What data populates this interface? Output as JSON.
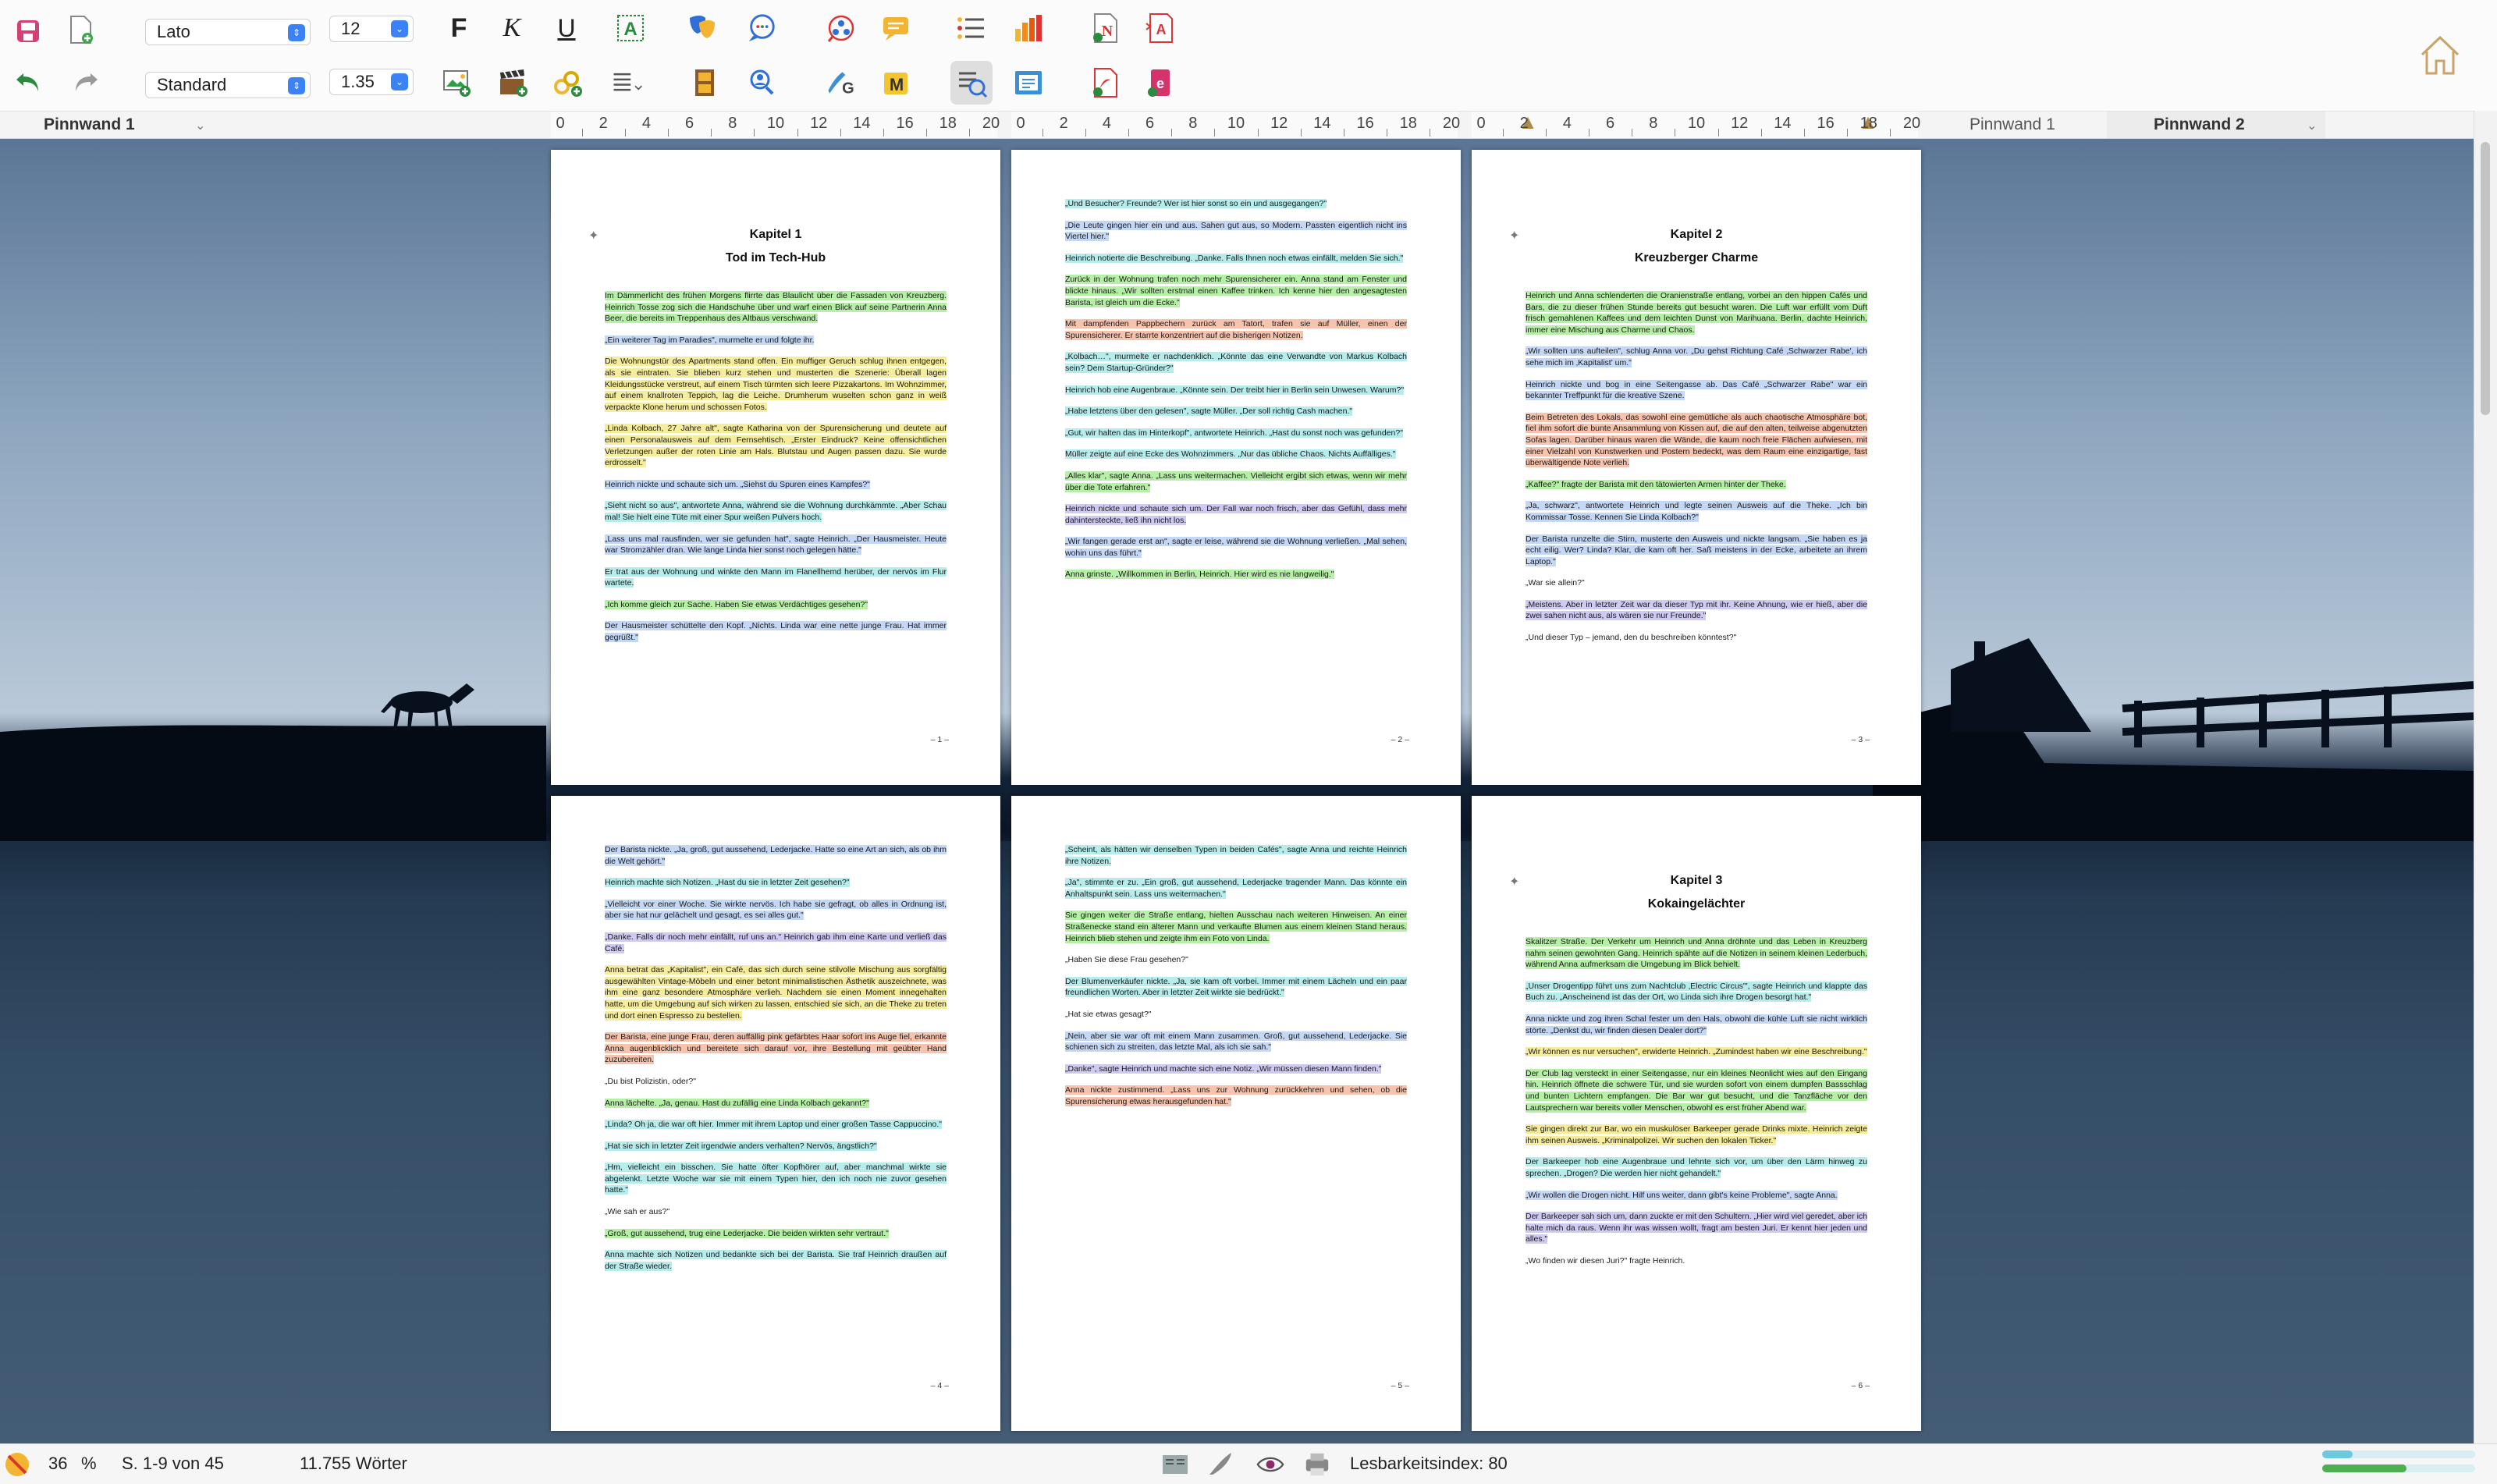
{
  "toolbar": {
    "font_family": "Lato",
    "font_size": "12",
    "style": "Standard",
    "line_spacing": "1.35",
    "bold_label": "F",
    "italic_label": "K",
    "underline_label": "U",
    "icons": [
      "save-icon",
      "new-document-icon",
      "bold-icon",
      "italic-icon",
      "underline-icon",
      "text-style-icon",
      "theater-masks-icon",
      "speech-bubbles-icon",
      "network-icon",
      "comment-icon",
      "list-icon",
      "bar-chart-icon",
      "name-list-icon",
      "text-analysis-icon",
      "undo-icon",
      "redo-icon",
      "add-picture-icon",
      "clapperboard-icon",
      "connect-icon",
      "list-format-icon",
      "timeline-icon",
      "person-search-icon",
      "edit-icon",
      "marker-icon",
      "review-icon",
      "export-icon",
      "pdf-icon",
      "ebook-icon",
      "home-icon"
    ]
  },
  "ruler_row": {
    "board_left": "Pinnwand 1",
    "board_right_1": "Pinnwand 1",
    "board_right_2": "Pinnwand 2",
    "ticks": [
      "0",
      "2",
      "4",
      "6",
      "8",
      "10",
      "12",
      "14",
      "16",
      "18",
      "20"
    ]
  },
  "pages": [
    {
      "chapter_num": "Kapitel 1",
      "chapter_title": "Tod im Tech-Hub",
      "page_label": "– 1 –",
      "paragraphs": [
        {
          "h": "green",
          "text": "Im Dämmerlicht des frühen Morgens flirrte das Blaulicht über die Fassaden von Kreuzberg. Heinrich Tosse zog sich die Handschuhe über und warf einen Blick auf seine Partnerin Anna Beer, die bereits im Treppenhaus des Altbaus verschwand."
        },
        {
          "h": "blue",
          "text": "„Ein weiterer Tag im Paradies\", murmelte er und folgte ihr."
        },
        {
          "h": "yellow",
          "text": "Die Wohnungstür des Apartments stand offen. Ein muffiger Geruch schlug ihnen entgegen, als sie eintraten. Sie blieben kurz stehen und musterten die Szenerie: Überall lagen Kleidungsstücke verstreut, auf einem Tisch türmten sich leere Pizzakartons. Im Wohnzimmer, auf einem knallroten Teppich, lag die Leiche. Drumherum wuselten schon ganz in weiß verpackte Klone herum und schossen Fotos."
        },
        {
          "h": "yellow",
          "text": "„Linda Kolbach, 27 Jahre alt\", sagte Katharina von der Spurensicherung und deutete auf einen Personalausweis auf dem Fernsehtisch. „Erster Eindruck? Keine offensichtlichen Verletzungen außer der roten Linie am Hals. Blutstau und Augen passen dazu. Sie wurde erdrosselt.\""
        },
        {
          "h": "blue",
          "text": "Heinrich nickte und schaute sich um. „Siehst du Spuren eines Kampfes?\""
        },
        {
          "h": "cyan",
          "text": "„Sieht nicht so aus\", antwortete Anna, während sie die Wohnung durchkämmte. „Aber Schau mal! Sie hielt eine Tüte mit einer Spur weißen Pulvers hoch."
        },
        {
          "h": "blue",
          "text": "„Lass uns mal rausfinden, wer sie gefunden hat\", sagte Heinrich. „Der Hausmeister. Heute war Stromzähler dran. Wie lange Linda hier sonst noch gelegen hätte.\""
        },
        {
          "h": "cyan",
          "text": "Er trat aus der Wohnung und winkte den Mann im Flanellhemd herüber, der nervös im Flur wartete."
        },
        {
          "h": "green",
          "text": "„Ich komme gleich zur Sache. Haben Sie etwas Verdächtiges gesehen?\""
        },
        {
          "h": "blue",
          "text": "Der Hausmeister schüttelte den Kopf. „Nichts. Linda war eine nette junge Frau. Hat immer gegrüßt.\""
        }
      ]
    },
    {
      "chapter_num": "",
      "chapter_title": "",
      "page_label": "– 2 –",
      "paragraphs": [
        {
          "h": "cyan",
          "text": "„Und Besucher? Freunde? Wer ist hier sonst so ein und ausgegangen?\""
        },
        {
          "h": "blue",
          "text": "„Die Leute gingen hier ein und aus. Sahen gut aus, so Modern. Passten eigentlich nicht ins Viertel hier.\""
        },
        {
          "h": "cyan",
          "text": "Heinrich notierte die Beschreibung. „Danke. Falls Ihnen noch etwas einfällt, melden Sie sich.\""
        },
        {
          "h": "green",
          "text": "Zurück in der Wohnung trafen noch mehr Spurensicherer ein. Anna stand am Fenster und blickte hinaus. „Wir sollten erstmal einen Kaffee trinken. Ich kenne hier den angesagtesten Barista, ist gleich um die Ecke.\""
        },
        {
          "h": "orange",
          "text": "Mit dampfenden Pappbechern zurück am Tatort, trafen sie auf Müller, einen der Spurensicherer. Er starrte konzentriert auf die bisherigen Notizen."
        },
        {
          "h": "cyan",
          "text": "„Kolbach…\", murmelte er nachdenklich. „Könnte das eine Verwandte von Markus Kolbach sein? Dem Startup-Gründer?\""
        },
        {
          "h": "cyan",
          "text": "Heinrich hob eine Augenbraue. „Könnte sein. Der treibt hier in Berlin sein Unwesen. Warum?\""
        },
        {
          "h": "cyan",
          "text": "„Habe letztens über den gelesen\", sagte Müller. „Der soll richtig Cash machen.\""
        },
        {
          "h": "cyan",
          "text": "„Gut, wir halten das im Hinterkopf\", antwortete Heinrich. „Hast du sonst noch was gefunden?\""
        },
        {
          "h": "cyan",
          "text": "Müller zeigte auf eine Ecke des Wohnzimmers. „Nur das übliche Chaos. Nichts Auffälliges.\""
        },
        {
          "h": "green",
          "text": "„Alles klar\", sagte Anna. „Lass uns weitermachen. Vielleicht ergibt sich etwas, wenn wir mehr über die Tote erfahren.\""
        },
        {
          "h": "purple",
          "text": "Heinrich nickte und schaute sich um. Der Fall war noch frisch, aber das Gefühl, dass mehr dahintersteckte, ließ ihn nicht los."
        },
        {
          "h": "blue",
          "text": "„Wir fangen gerade erst an\", sagte er leise, während sie die Wohnung verließen. „Mal sehen, wohin uns das führt.\""
        },
        {
          "h": "green",
          "text": "Anna grinste. „Willkommen in Berlin, Heinrich. Hier wird es nie langweilig.\""
        }
      ]
    },
    {
      "chapter_num": "Kapitel 2",
      "chapter_title": "Kreuzberger Charme",
      "page_label": "– 3 –",
      "paragraphs": [
        {
          "h": "green",
          "text": "Heinrich und Anna schlenderten die Oranienstraße entlang, vorbei an den hippen Cafés und Bars, die zu dieser frühen Stunde bereits gut besucht waren. Die Luft war erfüllt vom Duft frisch gemahlenen Kaffees und dem leichten Dunst von Marihuana. Berlin, dachte Heinrich, immer eine Mischung aus Charme und Chaos."
        },
        {
          "h": "blue",
          "text": "„Wir sollten uns aufteilen\", schlug Anna vor. „Du gehst Richtung Café ‚Schwarzer Rabe', ich sehe mich im ‚Kapitalist' um.\""
        },
        {
          "h": "blue",
          "text": "Heinrich nickte und bog in eine Seitengasse ab. Das Café „Schwarzer Rabe\" war ein bekannter Treffpunkt für die kreative Szene."
        },
        {
          "h": "orange",
          "text": "Beim Betreten des Lokals, das sowohl eine gemütliche als auch chaotische Atmosphäre bot, fiel ihm sofort die bunte Ansammlung von Kissen auf, die auf den alten, teilweise abgenutzten Sofas lagen. Darüber hinaus waren die Wände, die kaum noch freie Flächen aufwiesen, mit einer Vielzahl von Kunstwerken und Postern bedeckt, was dem Raum eine einzigartige, fast überwältigende Note verlieh."
        },
        {
          "h": "green",
          "text": "„Kaffee?\" fragte der Barista mit den tätowierten Armen hinter der Theke."
        },
        {
          "h": "blue",
          "text": "„Ja, schwarz\", antwortete Heinrich und legte seinen Ausweis auf die Theke. „Ich bin Kommissar Tosse. Kennen Sie Linda Kolbach?\""
        },
        {
          "h": "blue",
          "text": "Der Barista runzelte die Stirn, musterte den Ausweis und nickte langsam. „Sie haben es ja echt eilig. Wer? Linda? Klar, die kam oft her. Saß meistens in der Ecke, arbeitete an ihrem Laptop.\""
        },
        {
          "h": "none",
          "text": "„War sie allein?\""
        },
        {
          "h": "purple",
          "text": "„Meistens. Aber in letzter Zeit war da dieser Typ mit ihr. Keine Ahnung, wie er hieß, aber die zwei sahen nicht aus, als wären sie nur Freunde.\""
        },
        {
          "h": "none",
          "text": "„Und dieser Typ – jemand, den du beschreiben könntest?\""
        }
      ]
    },
    {
      "chapter_num": "",
      "chapter_title": "",
      "page_label": "– 4 –",
      "paragraphs": [
        {
          "h": "blue",
          "text": "Der Barista nickte. „Ja, groß, gut aussehend, Lederjacke. Hatte so eine Art an sich, als ob ihm die Welt gehört.\""
        },
        {
          "h": "cyan",
          "text": "Heinrich machte sich Notizen. „Hast du sie in letzter Zeit gesehen?\""
        },
        {
          "h": "blue",
          "text": "„Vielleicht vor einer Woche. Sie wirkte nervös. Ich habe sie gefragt, ob alles in Ordnung ist, aber sie hat nur gelächelt und gesagt, es sei alles gut.\""
        },
        {
          "h": "purple",
          "text": "„Danke. Falls dir noch mehr einfällt, ruf uns an.\" Heinrich gab ihm eine Karte und verließ das Café."
        },
        {
          "h": "yellow",
          "text": "Anna betrat das „Kapitalist\", ein Café, das sich durch seine stilvolle Mischung aus sorgfältig ausgewählten Vintage-Möbeln und einer betont minimalistischen Ästhetik auszeichnete, was ihm eine ganz besondere Atmosphäre verlieh. Nachdem sie einen Moment innegehalten hatte, um die Umgebung auf sich wirken zu lassen, entschied sie sich, an die Theke zu treten und dort einen Espresso zu bestellen."
        },
        {
          "h": "orange",
          "text": "Der Barista, eine junge Frau, deren auffällig pink gefärbtes Haar sofort ins Auge fiel, erkannte Anna augenblicklich und bereitete sich darauf vor, ihre Bestellung mit geübter Hand zuzubereiten."
        },
        {
          "h": "none",
          "text": "„Du bist Polizistin, oder?\""
        },
        {
          "h": "green",
          "text": "Anna lächelte. „Ja, genau. Hast du zufällig eine Linda Kolbach gekannt?\""
        },
        {
          "h": "cyan",
          "text": "„Linda? Oh ja, die war oft hier. Immer mit ihrem Laptop und einer großen Tasse Cappuccino.\""
        },
        {
          "h": "cyan",
          "text": "„Hat sie sich in letzter Zeit irgendwie anders verhalten? Nervös, ängstlich?\""
        },
        {
          "h": "cyan",
          "text": "„Hm, vielleicht ein bisschen. Sie hatte öfter Kopfhörer auf, aber manchmal wirkte sie abgelenkt. Letzte Woche war sie mit einem Typen hier, den ich noch nie zuvor gesehen hatte.\""
        },
        {
          "h": "none",
          "text": "„Wie sah er aus?\""
        },
        {
          "h": "green",
          "text": "„Groß, gut aussehend, trug eine Lederjacke. Die beiden wirkten sehr vertraut.\""
        },
        {
          "h": "cyan",
          "text": "Anna machte sich Notizen und bedankte sich bei der Barista. Sie traf Heinrich draußen auf der Straße wieder."
        }
      ]
    },
    {
      "chapter_num": "",
      "chapter_title": "",
      "page_label": "– 5 –",
      "paragraphs": [
        {
          "h": "cyan",
          "text": "„Scheint, als hätten wir denselben Typen in beiden Cafés\", sagte Anna und reichte Heinrich ihre Notizen."
        },
        {
          "h": "cyan",
          "text": "„Ja\", stimmte er zu. „Ein groß, gut aussehend, Lederjacke tragender Mann. Das könnte ein Anhaltspunkt sein. Lass uns weitermachen.\""
        },
        {
          "h": "green",
          "text": "Sie gingen weiter die Straße entlang, hielten Ausschau nach weiteren Hinweisen. An einer Straßenecke stand ein älterer Mann und verkaufte Blumen aus einem kleinen Stand heraus. Heinrich blieb stehen und zeigte ihm ein Foto von Linda."
        },
        {
          "h": "none",
          "text": "„Haben Sie diese Frau gesehen?\""
        },
        {
          "h": "cyan",
          "text": "Der Blumenverkäufer nickte. „Ja, sie kam oft vorbei. Immer mit einem Lächeln und ein paar freundlichen Worten. Aber in letzter Zeit wirkte sie bedrückt.\""
        },
        {
          "h": "none",
          "text": "„Hat sie etwas gesagt?\""
        },
        {
          "h": "blue",
          "text": "„Nein, aber sie war oft mit einem Mann zusammen. Groß, gut aussehend, Lederjacke. Sie schienen sich zu streiten, das letzte Mal, als ich sie sah.\""
        },
        {
          "h": "purple",
          "text": "„Danke\", sagte Heinrich und machte sich eine Notiz. „Wir müssen diesen Mann finden.\""
        },
        {
          "h": "orange",
          "text": "Anna nickte zustimmend. „Lass uns zur Wohnung zurückkehren und sehen, ob die Spurensicherung etwas herausgefunden hat.\""
        }
      ]
    },
    {
      "chapter_num": "Kapitel 3",
      "chapter_title": "Kokaingelächter",
      "page_label": "– 6 –",
      "paragraphs": [
        {
          "h": "green",
          "text": "Skalitzer Straße. Der Verkehr um Heinrich und Anna dröhnte und das Leben in Kreuzberg nahm seinen gewohnten Gang. Heinrich spähte auf die Notizen in seinem kleinen Lederbuch, während Anna aufmerksam die Umgebung im Blick behielt."
        },
        {
          "h": "cyan",
          "text": "„Unser Drogentipp führt uns zum Nachtclub ‚Electric Circus'\", sagte Heinrich und klappte das Buch zu. „Anscheinend ist das der Ort, wo Linda sich ihre Drogen besorgt hat.\""
        },
        {
          "h": "blue",
          "text": "Anna nickte und zog ihren Schal fester um den Hals, obwohl die kühle Luft sie nicht wirklich störte. „Denkst du, wir finden diesen Dealer dort?\""
        },
        {
          "h": "yellow",
          "text": "„Wir können es nur versuchen\", erwiderte Heinrich. „Zumindest haben wir eine Beschreibung.\""
        },
        {
          "h": "green",
          "text": "Der Club lag versteckt in einer Seitengasse, nur ein kleines Neonlicht wies auf den Eingang hin. Heinrich öffnete die schwere Tür, und sie wurden sofort von einem dumpfen Bassschlag und bunten Lichtern empfangen. Die Bar war gut besucht, und die Tanzfläche vor den Lautsprechern war bereits voller Menschen, obwohl es erst früher Abend war."
        },
        {
          "h": "yellow",
          "text": "Sie gingen direkt zur Bar, wo ein muskulöser Barkeeper gerade Drinks mixte. Heinrich zeigte ihm seinen Ausweis. „Kriminalpolizei. Wir suchen den lokalen Ticker.\""
        },
        {
          "h": "cyan",
          "text": "Der Barkeeper hob eine Augenbraue und lehnte sich vor, um über den Lärm hinweg zu sprechen. „Drogen? Die werden hier nicht gehandelt.\""
        },
        {
          "h": "blue",
          "text": "„Wir wollen die Drogen nicht. Hilf uns weiter, dann gibt's keine Probleme\", sagte Anna."
        },
        {
          "h": "purple",
          "text": "Der Barkeeper sah sich um, dann zuckte er mit den Schultern. „Hier wird viel geredet, aber ich halte mich da raus. Wenn ihr was wissen wollt, fragt am besten Juri. Er kennt hier jeden und alles.\""
        },
        {
          "h": "none",
          "text": "„Wo finden wir diesen Juri?\" fragte Heinrich."
        }
      ]
    }
  ],
  "status": {
    "zoom_value": "36",
    "zoom_unit": "%",
    "pages_info": "S. 1-9 von 45",
    "words": "11.755 Wörter",
    "readability": "Lesbarkeitsindex: 80",
    "progress_1": 0.2,
    "progress_2": 0.55
  },
  "colors": {
    "accent": "#3b82f6",
    "highlight_green": "#b6f0a6",
    "highlight_blue": "#c4d8f6",
    "highlight_yellow": "#f5ec9c",
    "highlight_cyan": "#b6ecec",
    "highlight_orange": "#f6c4ae",
    "highlight_purple": "#cfcaf1"
  }
}
